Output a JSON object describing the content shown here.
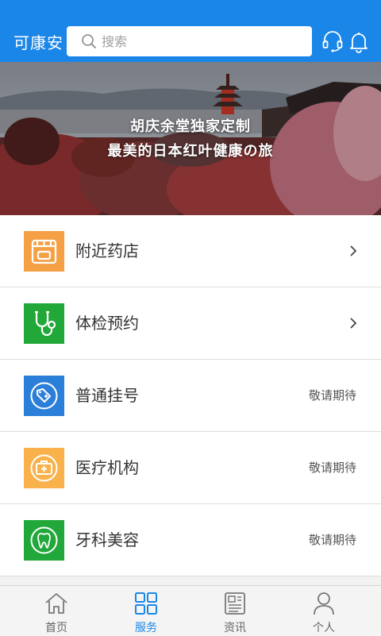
{
  "header": {
    "app_title": "可康安",
    "search_placeholder": "搜索",
    "icons": [
      "headset-icon",
      "bell-icon"
    ],
    "bg_color": "#1a86e8"
  },
  "banner": {
    "line1": "胡庆余堂独家定制",
    "line2": "最美的日本红叶健康の旅"
  },
  "services": [
    {
      "label": "附近药店",
      "icon": "pharmacy-store-icon",
      "color": "#f5a045",
      "action": "chevron"
    },
    {
      "label": "体检预约",
      "icon": "stethoscope-icon",
      "color": "#21a839",
      "action": "chevron"
    },
    {
      "label": "普通挂号",
      "icon": "tag-cross-icon",
      "color": "#2c7fd8",
      "status": "敬请期待"
    },
    {
      "label": "医疗机构",
      "icon": "medical-kit-icon",
      "color": "#f9b14c",
      "status": "敬请期待"
    },
    {
      "label": "牙科美容",
      "icon": "tooth-icon",
      "color": "#22a83a",
      "status": "敬请期待"
    }
  ],
  "tabs": [
    {
      "label": "首页",
      "icon": "home-icon",
      "active": false
    },
    {
      "label": "服务",
      "icon": "grid-icon",
      "active": true
    },
    {
      "label": "资讯",
      "icon": "news-icon",
      "active": false
    },
    {
      "label": "个人",
      "icon": "person-icon",
      "active": false
    }
  ]
}
